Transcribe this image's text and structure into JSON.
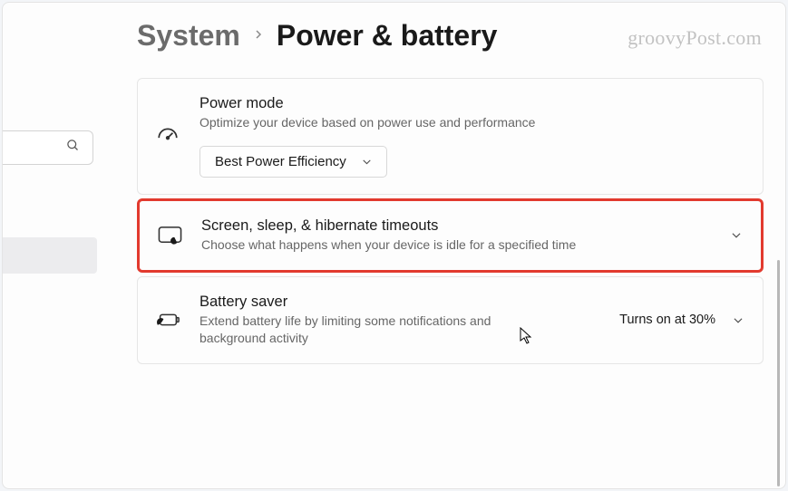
{
  "watermark": "groovyPost.com",
  "breadcrumb": {
    "parent": "System",
    "current": "Power & battery"
  },
  "cards": {
    "power_mode": {
      "title": "Power mode",
      "desc": "Optimize your device based on power use and performance",
      "dropdown_value": "Best Power Efficiency"
    },
    "timeouts": {
      "title": "Screen, sleep, & hibernate timeouts",
      "desc": "Choose what happens when your device is idle for a specified time"
    },
    "battery_saver": {
      "title": "Battery saver",
      "desc": "Extend battery life by limiting some notifications and background activity",
      "status": "Turns on at 30%"
    }
  }
}
